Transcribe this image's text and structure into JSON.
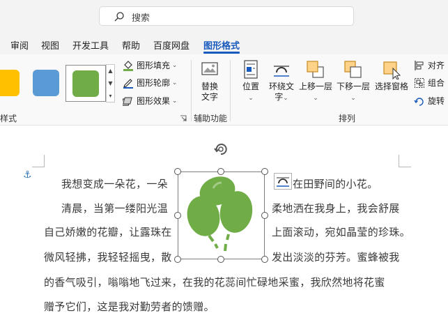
{
  "search": {
    "placeholder": "搜索"
  },
  "tabs": [
    {
      "label": "审阅"
    },
    {
      "label": "视图"
    },
    {
      "label": "开发工具"
    },
    {
      "label": "帮助"
    },
    {
      "label": "百度网盘"
    },
    {
      "label": "图形格式",
      "active": true
    }
  ],
  "ribbon": {
    "styles_group": {
      "label": "样式",
      "swatches": [
        {
          "name": "yellow",
          "color": "#ffc000"
        },
        {
          "name": "blue",
          "color": "#5b9bd5"
        },
        {
          "name": "green",
          "color": "#70ad47",
          "selected": true
        }
      ],
      "fill_label": "图形填充",
      "outline_label": "图形轮廓",
      "effects_label": "图形效果"
    },
    "accessibility_group": {
      "label": "辅助功能",
      "alt_text_label_1": "替换",
      "alt_text_label_2": "文字"
    },
    "arrange_group": {
      "label": "排列",
      "position_label": "位置",
      "wrap_text_label_1": "环绕文",
      "wrap_text_label_2": "字",
      "bring_forward_label": "上移一层",
      "send_backward_label": "下移一层",
      "selection_pane_label": "选择窗格",
      "align_label": "对齐",
      "group_label": "组合",
      "rotate_label": "旋转"
    }
  },
  "document": {
    "lines": [
      {
        "text_left": "我想变成一朵花，一朵",
        "text_right": "在田野间的小花。"
      },
      {
        "text_left": "清晨，当第一缕阳光温",
        "text_right": "柔地洒在我身上，我会舒展"
      },
      {
        "text_left": "自己娇嫩的花瓣，让露珠在",
        "text_right": "上面滚动，宛如晶莹的珍珠。"
      },
      {
        "text_left": "微风轻拂，我轻轻摇曳，散",
        "text_right": "发出淡淡的芬芳。蜜蜂被我"
      },
      {
        "text_full": "的香气吸引，嗡嗡地飞过来，在我的花蕊间忙碌地采蜜，我欣然地将花蜜"
      },
      {
        "text_full": "赠予它们，这是我对勤劳者的馈赠。"
      }
    ],
    "shape": {
      "icon": "balloons-icon",
      "color": "#70ad47"
    }
  },
  "colors": {
    "accent": "#185abd"
  }
}
